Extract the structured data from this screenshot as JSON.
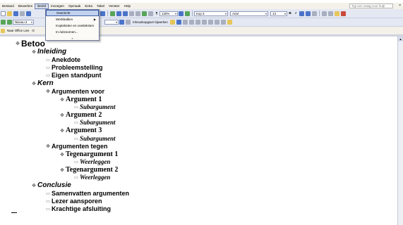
{
  "menubar": {
    "items": [
      "Bestand",
      "Bewerken",
      "Beeld",
      "Invoegen",
      "Opmaak",
      "Extra",
      "Tabel",
      "Venster",
      "Help"
    ],
    "help_placeholder": "Typ een vraag voor hulp",
    "close": "×"
  },
  "view_menu": {
    "items": [
      {
        "label": "Overzicht",
        "highlighted": true
      },
      {
        "label": "Werkbalken",
        "submenu": true
      },
      {
        "label": "Kopteksten en voetteksten"
      },
      {
        "label": "In-/uitzoomen..."
      }
    ],
    "more": "»"
  },
  "toolbar_standard": {
    "zoom": "120%",
    "style": "Kop 3",
    "font": "Arial",
    "size": "13",
    "bold": "B",
    "italic": "I"
  },
  "toolbar_outline": {
    "level": "Niveau 3",
    "toc_update": "Inhoudsopgave bijwerken"
  },
  "toolbar_office": {
    "label": "Naar Office Live",
    "extra": "O"
  },
  "outline": {
    "title": "Betoo",
    "heading_inleiding": "Inleiding",
    "anekdote": "Anekdote",
    "probleemstelling": "Probleemstelling",
    "eigen_standpunt": "Eigen standpunt",
    "heading_kern": "Kern",
    "argumenten_voor": "Argumenten voor",
    "argument_1": "Argument 1",
    "subargument_1": "Subargument",
    "argument_2": "Argument 2",
    "subargument_2": "Subargument",
    "argument_3": "Argument 3",
    "subargument_3": "Subargument",
    "argumenten_tegen": "Argumenten tegen",
    "tegenargument_1": "Tegenargument 1",
    "weerleggen_1": "Weerleggen",
    "tegenargument_2": "Tegenargument 2",
    "weerleggen_2": "Weerleggen",
    "heading_conclusie": "Conclusie",
    "samenvatten": "Samenvatten argumenten",
    "lezer": "Lezer aansporen",
    "afsluiting": "Krachtige afsluiting"
  }
}
